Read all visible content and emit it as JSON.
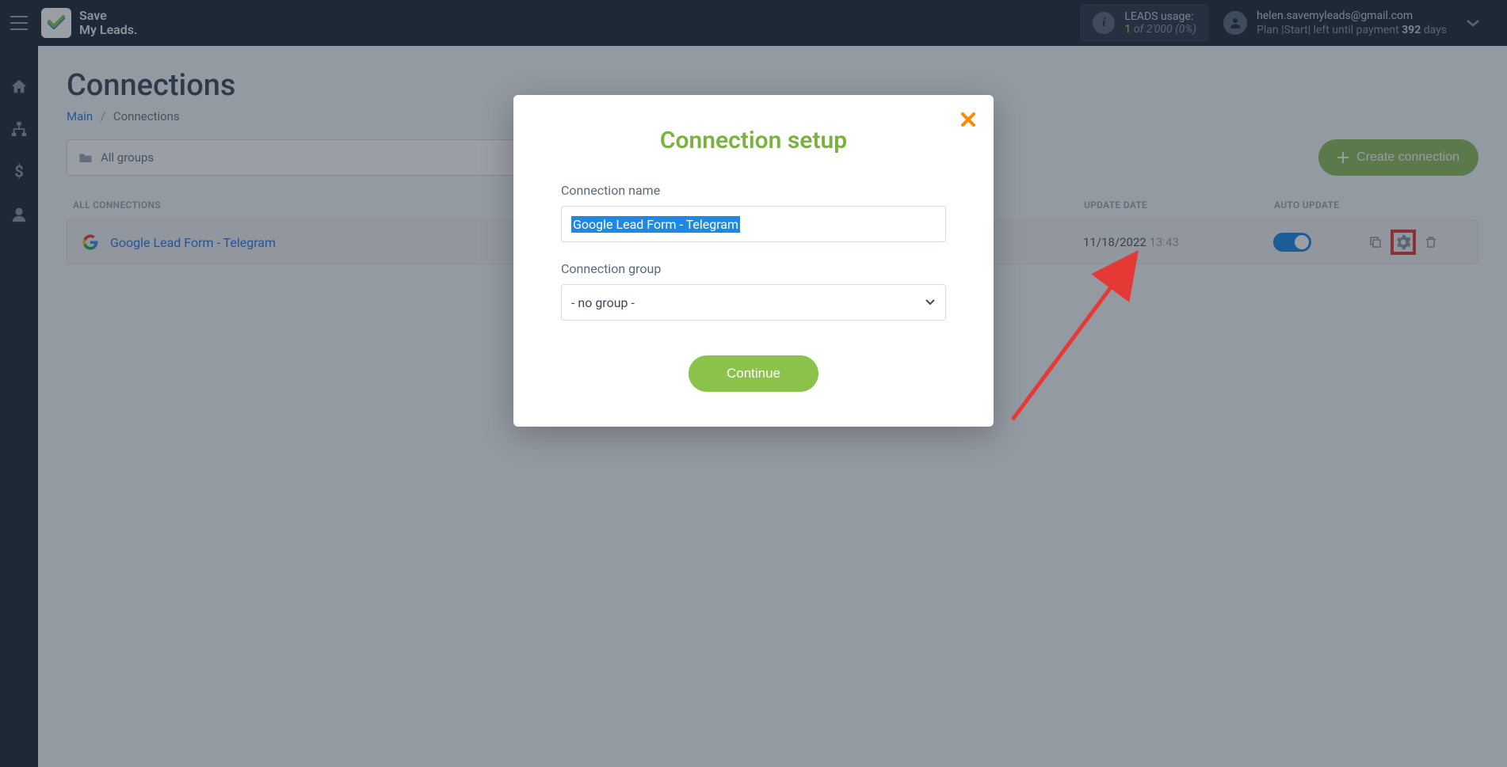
{
  "brand": {
    "line1": "Save",
    "line2": "My Leads."
  },
  "usage": {
    "label": "LEADS usage:",
    "count": "1",
    "of_word": "of",
    "total": "2'000",
    "pct": "(0%)"
  },
  "user": {
    "email": "helen.savemyleads@gmail.com",
    "plan_prefix": "Plan |Start| left until payment",
    "days": "392",
    "days_word": "days"
  },
  "page": {
    "title": "Connections",
    "breadcrumb_main": "Main",
    "breadcrumb_current": "Connections"
  },
  "toolbar": {
    "group_label": "All groups",
    "create_label": "Create connection"
  },
  "table": {
    "head_all": "ALL CONNECTIONS",
    "head_date": "UPDATE DATE",
    "head_auto": "AUTO UPDATE"
  },
  "rows": [
    {
      "name": "Google Lead Form - Telegram",
      "date": "11/18/2022",
      "time": "13:43",
      "auto": true
    }
  ],
  "modal": {
    "title": "Connection setup",
    "name_label": "Connection name",
    "name_value": "Google Lead Form - Telegram",
    "group_label": "Connection group",
    "group_value": "- no group -",
    "continue": "Continue"
  }
}
